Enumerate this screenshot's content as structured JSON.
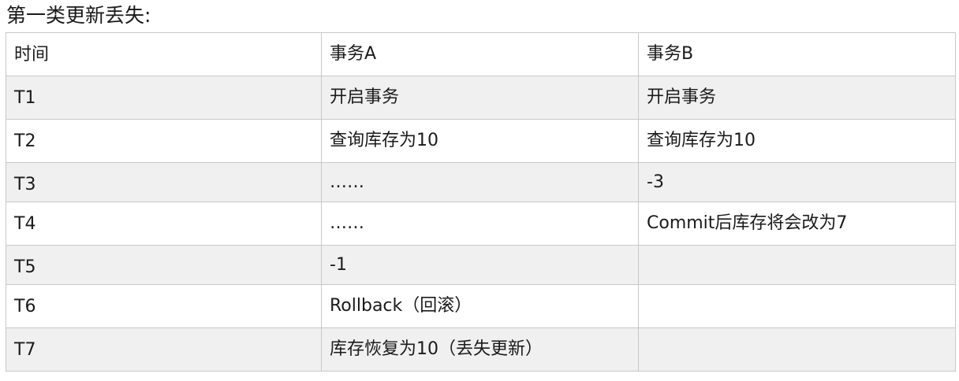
{
  "title": "第一类更新丢失:",
  "table": {
    "headers": [
      "时间",
      "事务A",
      "事务B"
    ],
    "rows": [
      [
        "T1",
        "开启事务",
        "开启事务"
      ],
      [
        "T2",
        "查询库存为10",
        "查询库存为10"
      ],
      [
        "T3",
        "……",
        "-3"
      ],
      [
        "T4",
        "……",
        "Commit后库存将会改为7"
      ],
      [
        "T5",
        "-1",
        ""
      ],
      [
        "T6",
        "Rollback（回滚）",
        ""
      ],
      [
        "T7",
        "库存恢复为10（丢失更新）",
        ""
      ]
    ]
  }
}
